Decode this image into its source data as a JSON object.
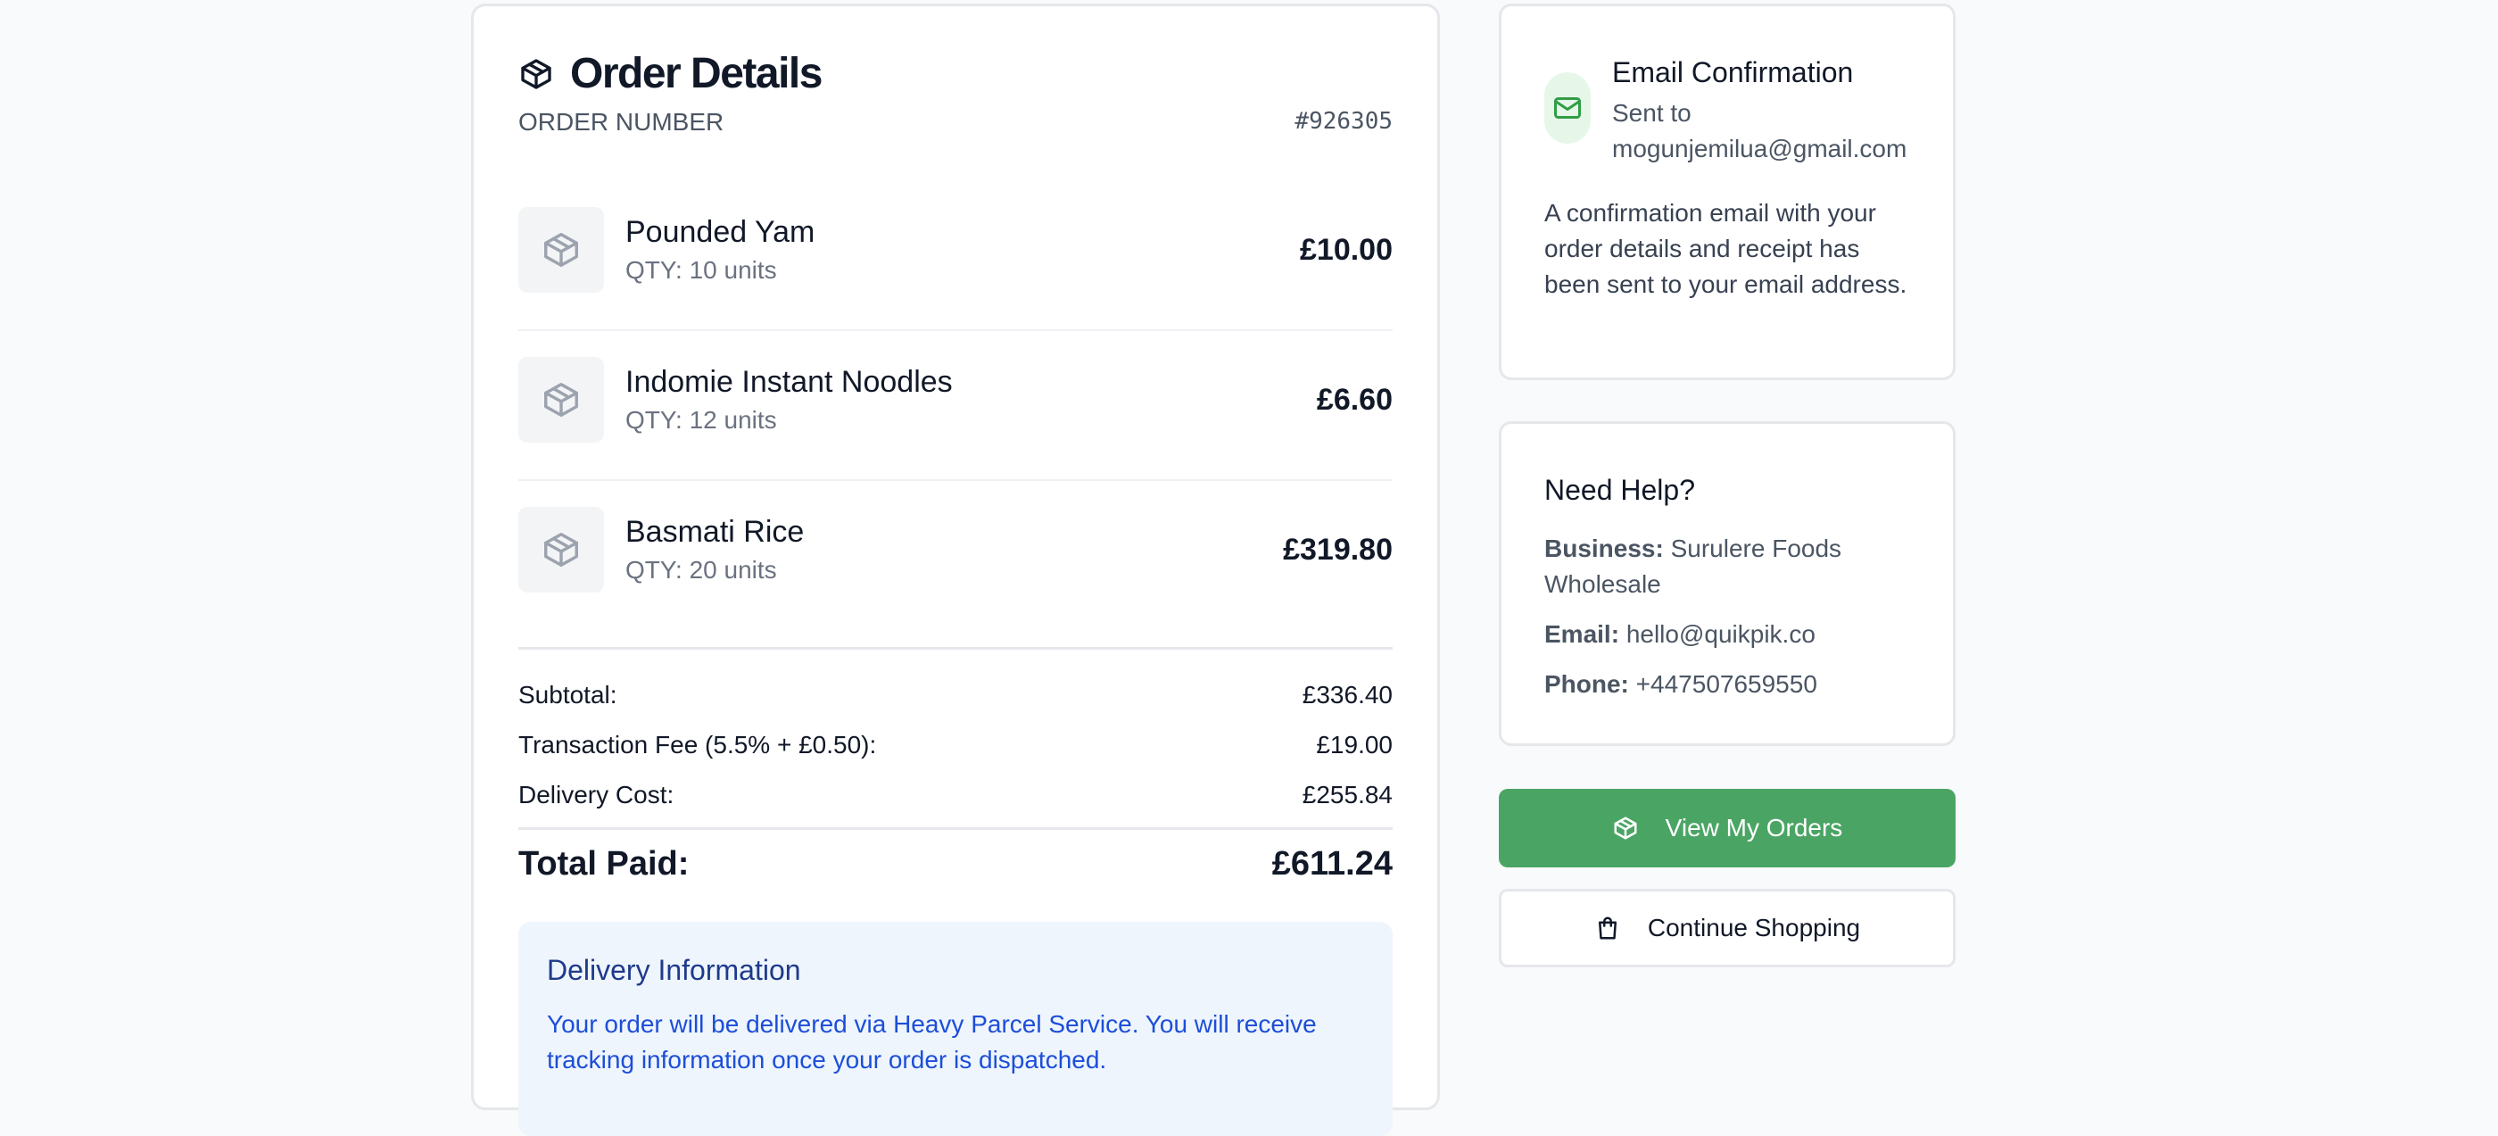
{
  "order": {
    "title": "Order Details",
    "icon": "package-icon",
    "order_number_label": "ORDER NUMBER",
    "order_number_value": "#926305",
    "items": [
      {
        "name": "Pounded Yam",
        "qty": "QTY: 10 units",
        "price": "£10.00",
        "icon": "package-icon"
      },
      {
        "name": "Indomie Instant Noodles",
        "qty": "QTY: 12 units",
        "price": "£6.60",
        "icon": "package-icon"
      },
      {
        "name": "Basmati Rice",
        "qty": "QTY: 20 units",
        "price": "£319.80",
        "icon": "package-icon"
      }
    ],
    "summary": {
      "subtotal_label": "Subtotal:",
      "subtotal_value": "£336.40",
      "fee_label": "Transaction Fee (5.5% + £0.50):",
      "fee_value": "£19.00",
      "delivery_label": "Delivery Cost:",
      "delivery_value": "£255.84",
      "total_label": "Total Paid:",
      "total_value": "£611.24"
    },
    "delivery": {
      "title": "Delivery Information",
      "text": "Your order will be delivered via Heavy Parcel Service. You will receive tracking information once your order is dispatched."
    }
  },
  "email_confirmation": {
    "icon": "mail-icon",
    "title": "Email Confirmation",
    "sent_to": "Sent to mogunjemilua@gmail.com",
    "description": "A confirmation email with your order details and receipt has been sent to your email address."
  },
  "help": {
    "title": "Need Help?",
    "business_label": "Business:",
    "business_value": "Surulere Foods Wholesale",
    "email_label": "Email:",
    "email_value": "hello@quikpik.co",
    "phone_label": "Phone:",
    "phone_value": "+447507659550"
  },
  "actions": {
    "view_orders_label": "View My Orders",
    "view_orders_icon": "package-icon",
    "continue_label": "Continue Shopping",
    "continue_icon": "shopping-bag-icon"
  },
  "colors": {
    "accent_green": "#4aa564",
    "info_bg": "#eef5fd",
    "info_text": "#1d4ed8"
  }
}
